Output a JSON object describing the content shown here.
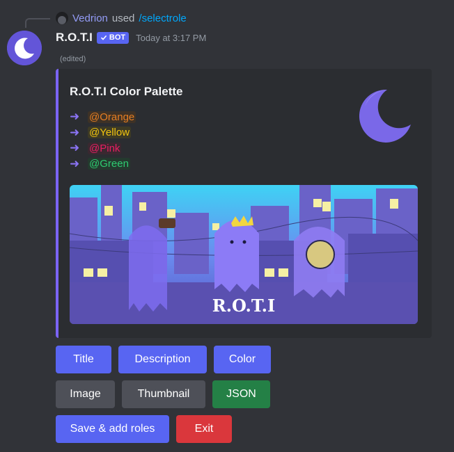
{
  "reply": {
    "user": "Vedrion",
    "used": "used",
    "command": "/selectrole"
  },
  "message": {
    "username": "R.O.T.I",
    "bot_tag": "BOT",
    "timestamp": "Today at 3:17 PM",
    "edited": "(edited)"
  },
  "embed": {
    "accent_color": "#7b64f4",
    "title": "R.O.T.I Color Palette",
    "roles": [
      {
        "arrow": "➜",
        "label": "@Orange",
        "color": "#e67e22",
        "bg": "#3e3226"
      },
      {
        "arrow": "➜",
        "label": "@Yellow",
        "color": "#f1c40f",
        "bg": "#3d3a25"
      },
      {
        "arrow": "➜",
        "label": "@Pink",
        "color": "#e91e63",
        "bg": "#3a2830"
      },
      {
        "arrow": "➜",
        "label": "@Green",
        "color": "#2ecc71",
        "bg": "#243a2e"
      }
    ],
    "image_caption": "R.O.T.I"
  },
  "buttons": {
    "title": "Title",
    "description": "Description",
    "color": "Color",
    "image": "Image",
    "thumbnail": "Thumbnail",
    "json": "JSON",
    "save": "Save & add roles",
    "exit": "Exit"
  },
  "colors": {
    "primary": "#5865f2",
    "secondary": "#4e5058",
    "success": "#248046",
    "danger": "#da373c"
  },
  "icons": {
    "avatar": "crescent-moon-icon",
    "thumbnail": "crescent-moon-icon",
    "verified": "checkmark-icon"
  }
}
